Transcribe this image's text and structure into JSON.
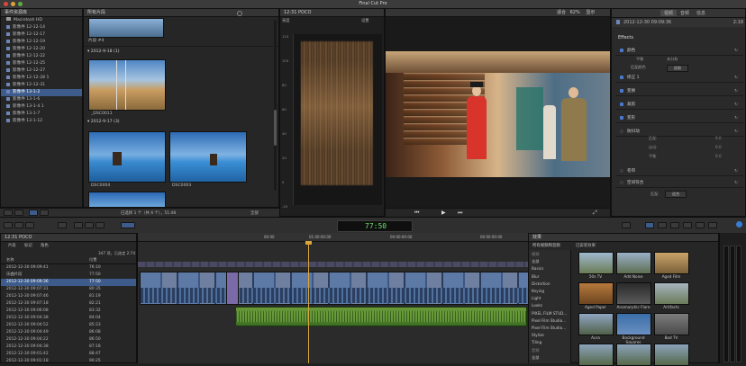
{
  "app": {
    "title": "Final Cut Pro"
  },
  "library": {
    "header": "事件资源库",
    "root": "Macintosh HD",
    "events": [
      "影像件 12-12-14",
      "影像件 12-12-17",
      "影像件 12-12-19",
      "影像件 12-12-20",
      "影像件 12-12-22",
      "影像件 12-12-25",
      "影像件 12-12-27",
      "影像件 12-12-28 1",
      "影像件 12-12-31",
      "影像件 13-1-2",
      "影像件 13-1-6",
      "影像件 13-1-4 1",
      "影像件 13-1-7",
      "影像件 13-1-12"
    ],
    "selected_index": 9
  },
  "browser": {
    "header": "所有片段",
    "top_clip": "片段 #4",
    "groups": [
      {
        "title": "2012-9-18",
        "count": "(1)"
      },
      {
        "title": "2012-9-17",
        "count": "(3)"
      }
    ],
    "clips": [
      "_DSC0011",
      "DSC0004",
      "DSC0003"
    ],
    "footer_status": "已选择 1 个（共 6 个），51:48",
    "footer_all": "全部"
  },
  "scopes": {
    "header": "12:31  POCO",
    "mode": "亮度",
    "setting": "设置",
    "y_labels": [
      "120",
      "100",
      "80",
      "60",
      "40",
      "20",
      "0",
      "-20"
    ]
  },
  "viewer": {
    "zoom_label": "适合",
    "zoom": "62%",
    "view": "显示"
  },
  "timecode": "77:50",
  "inspector": {
    "title": "2012-12-30 09:09:36",
    "duration": "2:18",
    "tabs": [
      "视频",
      "音频",
      "信息"
    ],
    "effects_heading": "Effects",
    "rows": [
      {
        "name": "颜色",
        "checked": true
      },
      {
        "name": "修正 1",
        "checked": true
      },
      {
        "name": "变换",
        "checked": true
      },
      {
        "name": "裁剪",
        "checked": true
      },
      {
        "name": "变形",
        "checked": true
      },
      {
        "name": "防抖动",
        "checked": false
      },
      {
        "name": "卷帘",
        "checked": false
      },
      {
        "name": "空间符合",
        "checked": false
      }
    ],
    "sub_labels": [
      "匹配",
      "自动",
      "平衡",
      "关",
      "分析 "
    ],
    "value_labels": [
      "0.0",
      "0.0",
      "0.0"
    ],
    "pairs": [
      [
        "平衡",
        "未分析"
      ],
      [
        "匹配颜色",
        "选取"
      ]
    ],
    "spatial_value": "适合"
  },
  "timeline": {
    "project": "12:31  POCO",
    "index_tabs": [
      "片段",
      "标记",
      "角色"
    ],
    "index_count": "347 项，已选定 2:74",
    "columns": [
      "名称",
      "位置"
    ],
    "rows": [
      {
        "name": "2012-12-30 09:09:41",
        "pos": "76:10"
      },
      {
        "name": "乐曲片段",
        "pos": "77:50"
      },
      {
        "name": "2012-12-30 09:09:36",
        "pos": "77:50"
      },
      {
        "name": "2012-12-30 09:07:31",
        "pos": "80:35"
      },
      {
        "name": "2012-12-30 09:07:46",
        "pos": "81:19"
      },
      {
        "name": "2012-12-30 09:07:18",
        "pos": "82:21"
      },
      {
        "name": "2012-12-30 09:06:08",
        "pos": "83:32"
      },
      {
        "name": "2012-12-30 09:04:38",
        "pos": "84:04"
      },
      {
        "name": "2012-12-30 09:04:52",
        "pos": "85:23"
      },
      {
        "name": "2012-12-30 09:04:49",
        "pos": "86:08"
      },
      {
        "name": "2012-12-30 09:04:22",
        "pos": "86:50"
      },
      {
        "name": "2012-12-30 09:04:38",
        "pos": "87:18"
      },
      {
        "name": "2012-12-30 09:01:42",
        "pos": "88:47"
      },
      {
        "name": "2012-12-30 09:01:18",
        "pos": "90:25"
      }
    ],
    "selected_index": 2,
    "ruler": [
      "00:00",
      "01:00:00:00",
      "00:00:00:00",
      "00:00:00:00"
    ]
  },
  "effects_browser": {
    "header": "效果",
    "subheader": "所有视频和音频",
    "installed_label": "已安装效果",
    "categories": [
      "视频",
      "全部",
      "Basics",
      "Blur",
      "Distortion",
      "Keying",
      "Light",
      "Looks",
      "PIXEL FILM STUD...",
      "Pixel Film Studio...",
      "Pixel Film Studio...",
      "Stylize",
      "Tiling",
      "音频",
      "全部"
    ],
    "items": [
      "50s TV",
      "Add Noise",
      "Aged Film",
      "Aged Paper",
      "Anamorphic Flare",
      "Artifacts",
      "Aura",
      "Background Squares",
      "Bad TV",
      "",
      "",
      ""
    ]
  },
  "colors": {
    "accent": "#3d5c8c",
    "video_clip": "#4f6f9a",
    "audio_clip": "#4c8a3a",
    "playhead": "#d9a53a"
  },
  "icons": [
    "close-icon",
    "minimize-icon",
    "zoom-icon",
    "search-icon",
    "play-icon",
    "skimming-icon",
    "gear-icon"
  ]
}
